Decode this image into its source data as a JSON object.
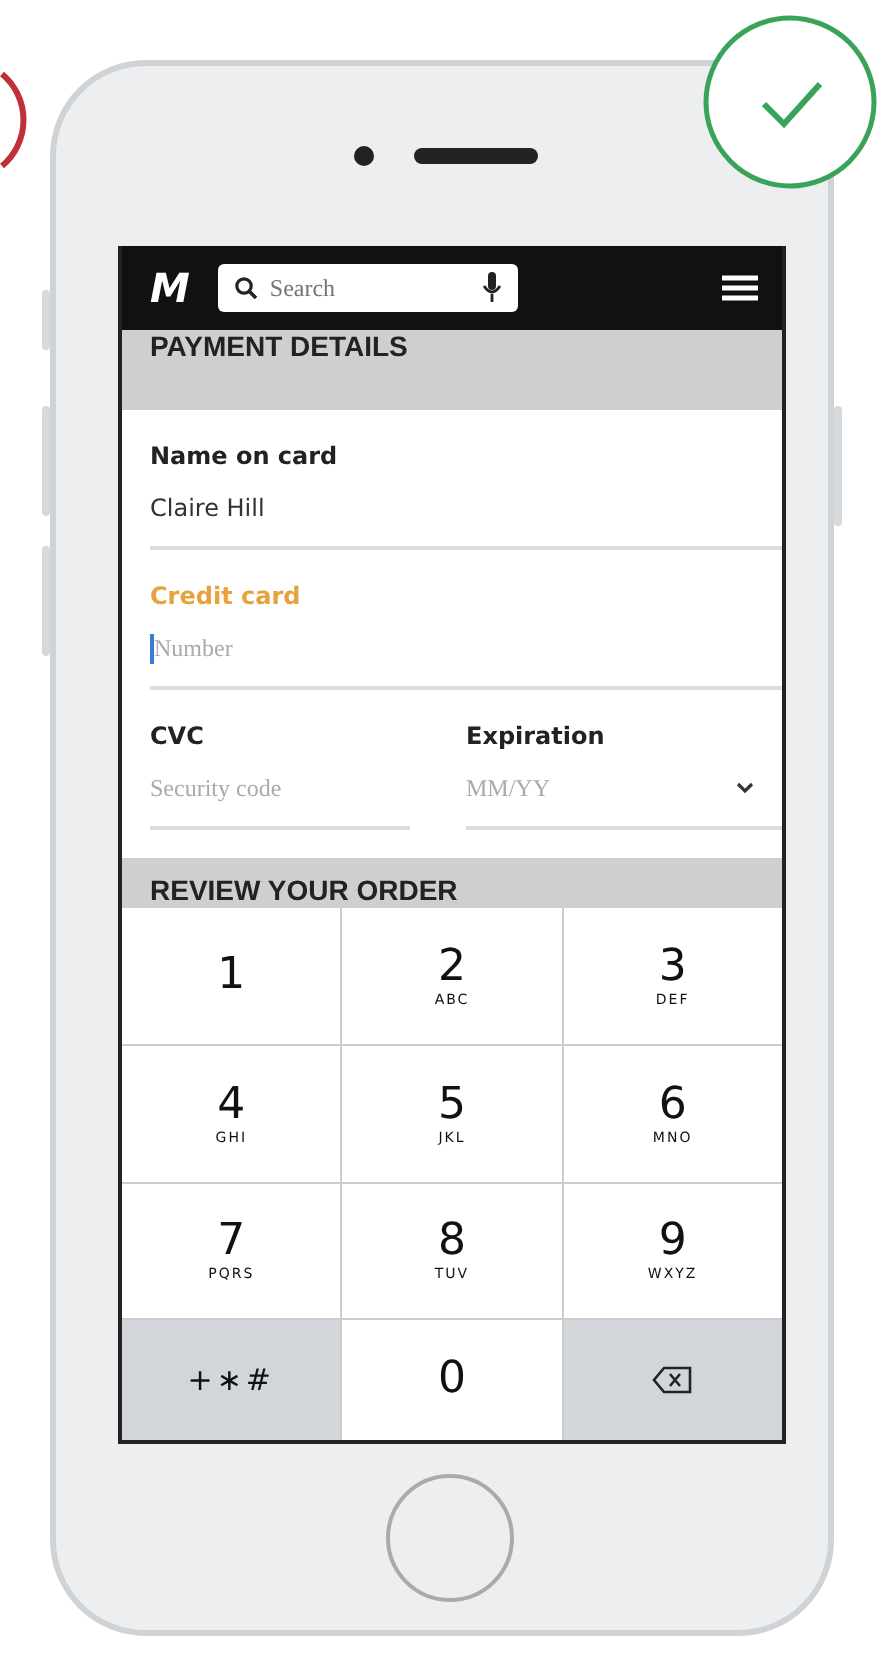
{
  "header": {
    "logo": "M",
    "search": {
      "placeholder": "Search"
    }
  },
  "payment_section": {
    "title": "PAYMENT DETAILS"
  },
  "fields": [
    {
      "label": "Name on card",
      "value": "Claire Hill",
      "focused": false
    },
    {
      "label": "Credit card",
      "placeholder": "Number",
      "focused": true
    }
  ],
  "half_fields": [
    {
      "kind": "text",
      "label": "CVC",
      "placeholder": "Security code"
    },
    {
      "kind": "select",
      "label": "Expiration",
      "placeholder": "MM/YY"
    }
  ],
  "review_section": {
    "title": "REVIEW YOUR ORDER"
  },
  "keypad": [
    {
      "kind": "digit",
      "digit": "1"
    },
    {
      "kind": "digit",
      "digit": "2",
      "letters": "ABC"
    },
    {
      "kind": "digit",
      "digit": "3",
      "letters": "DEF"
    },
    {
      "kind": "digit",
      "digit": "4",
      "letters": "GHI"
    },
    {
      "kind": "digit",
      "digit": "5",
      "letters": "JKL"
    },
    {
      "kind": "digit",
      "digit": "6",
      "letters": "MNO"
    },
    {
      "kind": "digit",
      "digit": "7",
      "letters": "PQRS"
    },
    {
      "kind": "digit",
      "digit": "8",
      "letters": "TUV"
    },
    {
      "kind": "digit",
      "digit": "9",
      "letters": "WXYZ"
    },
    {
      "kind": "symbols",
      "digit": "+∗#"
    },
    {
      "kind": "digit",
      "digit": "0"
    },
    {
      "kind": "delete"
    }
  ]
}
